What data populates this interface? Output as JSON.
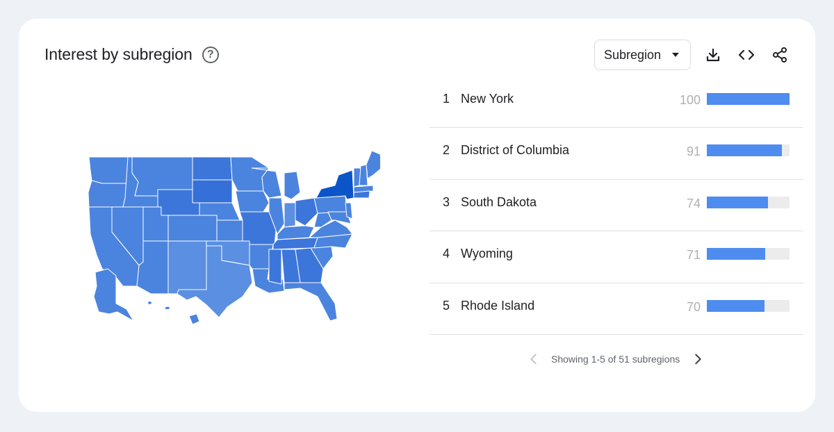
{
  "header": {
    "title": "Interest by subregion",
    "help_icon": "help-circle-icon",
    "resolution_select": {
      "selected": "Subregion"
    },
    "tools": [
      {
        "name": "download-icon",
        "label": "Download"
      },
      {
        "name": "embed-code-icon",
        "label": "Embed"
      },
      {
        "name": "share-icon",
        "label": "Share"
      }
    ]
  },
  "colors": {
    "bar_fill": "#4e8cf0",
    "bar_track": "#ececec",
    "map_max": "#0b55c9",
    "map_base": "#4b84de",
    "map_light": "#5a8fe2",
    "page_bg": "#eef2f7",
    "card_bg": "#ffffff"
  },
  "ranking": [
    {
      "rank": "1",
      "name": "New York",
      "value": 100
    },
    {
      "rank": "2",
      "name": "District of Columbia",
      "value": 91
    },
    {
      "rank": "3",
      "name": "South Dakota",
      "value": 74
    },
    {
      "rank": "4",
      "name": "Wyoming",
      "value": 71
    },
    {
      "rank": "5",
      "name": "Rhode Island",
      "value": 70
    }
  ],
  "pagination": {
    "label": "Showing 1-5 of 51 subregions",
    "prev_enabled": false,
    "next_enabled": true
  },
  "map": {
    "region": "United States",
    "highlighted": "New York"
  }
}
